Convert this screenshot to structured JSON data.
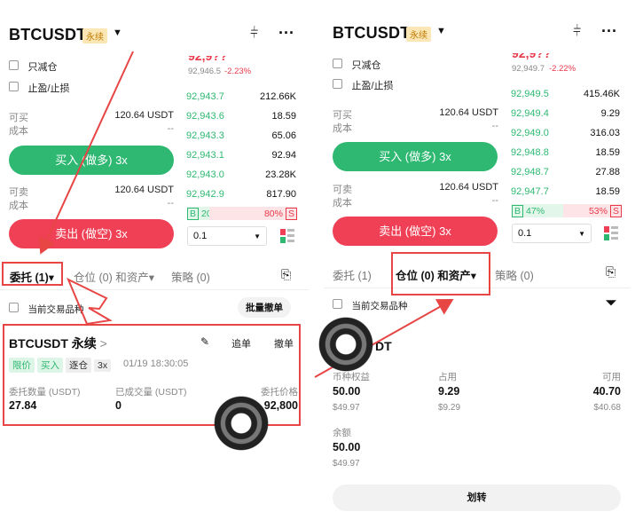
{
  "left": {
    "symbol": "BTCUSDT",
    "perp_badge": "永续",
    "price_partial": "92,9??",
    "mark_price": "92,946.5",
    "change": "-2.23%",
    "reduce_only": "只减仓",
    "tp_sl": "止盈/止损",
    "buyable_label": "可买",
    "buyable_value": "120.64 USDT",
    "cost_label": "成本",
    "cost_value": "--",
    "buy_button": "买入 (做多) 3x",
    "sellable_label": "可卖",
    "sellable_value": "120.64 USDT",
    "cost2_label": "成本",
    "cost2_value": "--",
    "sell_button": "卖出 (做空) 3x",
    "orderbook": [
      {
        "price": "92,943.7",
        "qty": "212.66K"
      },
      {
        "price": "92,943.6",
        "qty": "18.59"
      },
      {
        "price": "92,943.3",
        "qty": "65.06"
      },
      {
        "price": "92,943.1",
        "qty": "92.94"
      },
      {
        "price": "92,943.0",
        "qty": "23.28K"
      },
      {
        "price": "92,942.9",
        "qty": "817.90"
      }
    ],
    "ratio_b_label": "B",
    "ratio_b": "20%",
    "ratio_s": "80%",
    "ratio_s_label": "S",
    "tick_size": "0.1",
    "tabs": {
      "orders": "委托 (1)",
      "positions": "仓位 (0) 和资产",
      "strategy": "策略 (0)"
    },
    "current_symbol_only": "当前交易品种",
    "batch_cancel": "批量撤单",
    "order": {
      "title": "BTCUSDT 永续",
      "chevron": ">",
      "chase": "追单",
      "cancel": "撤单",
      "tags": [
        "限价",
        "买入",
        "逐仓",
        "3x"
      ],
      "time": "01/19 18:30:05",
      "qty_label": "委托数量 (USDT)",
      "qty_value": "27.84",
      "filled_label": "已成交量 (USDT)",
      "filled_value": "0",
      "price_label": "委托价格",
      "price_value": "92,800"
    }
  },
  "right": {
    "symbol": "BTCUSDT",
    "perp_badge": "永续",
    "price_partial": "92,9??",
    "mark_price": "92,949.7",
    "change": "-2.22%",
    "reduce_only": "只减仓",
    "tp_sl": "止盈/止损",
    "buyable_label": "可买",
    "buyable_value": "120.64 USDT",
    "cost_label": "成本",
    "cost_value": "--",
    "buy_button": "买入 (做多) 3x",
    "sellable_label": "可卖",
    "sellable_value": "120.64 USDT",
    "cost2_label": "成本",
    "cost2_value": "--",
    "sell_button": "卖出 (做空) 3x",
    "orderbook": [
      {
        "price": "92,949.5",
        "qty": "415.46K"
      },
      {
        "price": "92,949.4",
        "qty": "9.29"
      },
      {
        "price": "92,949.0",
        "qty": "316.03"
      },
      {
        "price": "92,948.8",
        "qty": "18.59"
      },
      {
        "price": "92,948.7",
        "qty": "27.88"
      },
      {
        "price": "92,947.7",
        "qty": "18.59"
      }
    ],
    "ratio_b_label": "B",
    "ratio_b": "47%",
    "ratio_s": "53%",
    "ratio_s_label": "S",
    "tick_size": "0.1",
    "tabs": {
      "orders": "委托 (1)",
      "positions": "仓位 (0) 和资产",
      "strategy": "策略 (0)"
    },
    "current_symbol_only": "当前交易品种",
    "asset": {
      "title_partial": "DT",
      "equity_label": "币种权益",
      "equity_value": "50.00",
      "equity_usd": "$49.97",
      "used_label": "占用",
      "used_value": "9.29",
      "used_usd": "$9.29",
      "avail_label": "可用",
      "avail_value": "40.70",
      "avail_usd": "$40.68",
      "balance_label": "余额",
      "balance_value": "50.00",
      "balance_usd": "$49.97"
    },
    "transfer_button": "划转"
  },
  "colors": {
    "green": "#2eb872",
    "red": "#ef4056",
    "annotation": "#e84545"
  }
}
